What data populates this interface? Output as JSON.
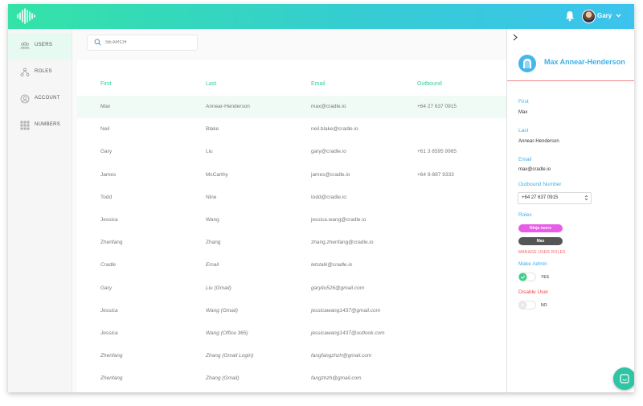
{
  "colors": {
    "accent": "#35cf96",
    "link_blue": "#3cb0e6",
    "danger": "#ef4b4b",
    "header_gradient": [
      "#34e3a6",
      "#3cc3ee"
    ]
  },
  "header": {
    "logo_icon": "waveform-logo-icon",
    "notification_icon": "bell-icon",
    "user": {
      "name": "Gary",
      "menu_icon": "chevron-down-icon"
    }
  },
  "sidebar": {
    "items": [
      {
        "label": "USERS",
        "icon": "users-icon",
        "active": true
      },
      {
        "label": "ROLES",
        "icon": "roles-icon",
        "active": false
      },
      {
        "label": "ACCOUNT",
        "icon": "account-icon",
        "active": false
      },
      {
        "label": "NUMBERS",
        "icon": "numbers-grid-icon",
        "active": false
      }
    ]
  },
  "search": {
    "placeholder": "SEARCH",
    "value": ""
  },
  "table": {
    "columns": [
      "First",
      "Last",
      "Email",
      "Outbound"
    ],
    "rows": [
      {
        "first": "Max",
        "last": "Annear-Henderson",
        "email": "max@cradle.io",
        "outbound": "+64 27 637 0915"
      },
      {
        "first": "Neil",
        "last": "Blake",
        "email": "neil.blake@cradle.io",
        "outbound": ""
      },
      {
        "first": "Gary",
        "last": "Liu",
        "email": "gary@cradle.io",
        "outbound": "+61 3 8595 9965"
      },
      {
        "first": "James",
        "last": "McCarthy",
        "email": "james@cradle.io",
        "outbound": "+64 9-887 9333"
      },
      {
        "first": "Todd",
        "last": "Nine",
        "email": "todd@cradle.io",
        "outbound": ""
      },
      {
        "first": "Jessica",
        "last": "Wang",
        "email": "jessica.wang@cradle.io",
        "outbound": ""
      },
      {
        "first": "Zhenfang",
        "last": "Zhang",
        "email": "zhang.zhenfang@cradle.io",
        "outbound": ""
      },
      {
        "first": "Cradle",
        "last": "Email",
        "email": "letstalk@cradle.io",
        "outbound": ""
      },
      {
        "first": "Gary",
        "last": "Liu (Gmail)",
        "email": "garyliu526@gmail.com",
        "outbound": ""
      },
      {
        "first": "Jessica",
        "last": "Wang (Gmail)",
        "email": "jessicawang1437@gmail.com",
        "outbound": ""
      },
      {
        "first": "Jessica",
        "last": "Wang (Office 365)",
        "email": "jessicawang1437@outlook.com",
        "outbound": ""
      },
      {
        "first": "Zhenfang",
        "last": "Zhang (Gmail Login)",
        "email": "fangfangzhzh@gmail.com",
        "outbound": ""
      },
      {
        "first": "Zhenfang",
        "last": "Zhang (Gmail)",
        "email": "fangzhzh@gmail.com",
        "outbound": ""
      }
    ]
  },
  "detail": {
    "name": "Max Annear-Henderson",
    "first_label": "First",
    "first_value": "Max",
    "last_label": "Last",
    "last_value": "Annear-Henderson",
    "email_label": "Email",
    "email_value": "max@cradle.io",
    "outbound_label": "Outbound Number",
    "outbound_value": "+64 27 637 0915",
    "roles_label": "Roles",
    "roles": [
      {
        "label": "Ninja neers",
        "color": "#e85ce8"
      },
      {
        "label": "Max",
        "color": "#555555"
      }
    ],
    "manage_roles": "MANAGE USER ROLES",
    "make_admin_label": "Make Admin",
    "make_admin_value": "YES",
    "disable_label": "Disable User",
    "disable_value": "NO"
  }
}
